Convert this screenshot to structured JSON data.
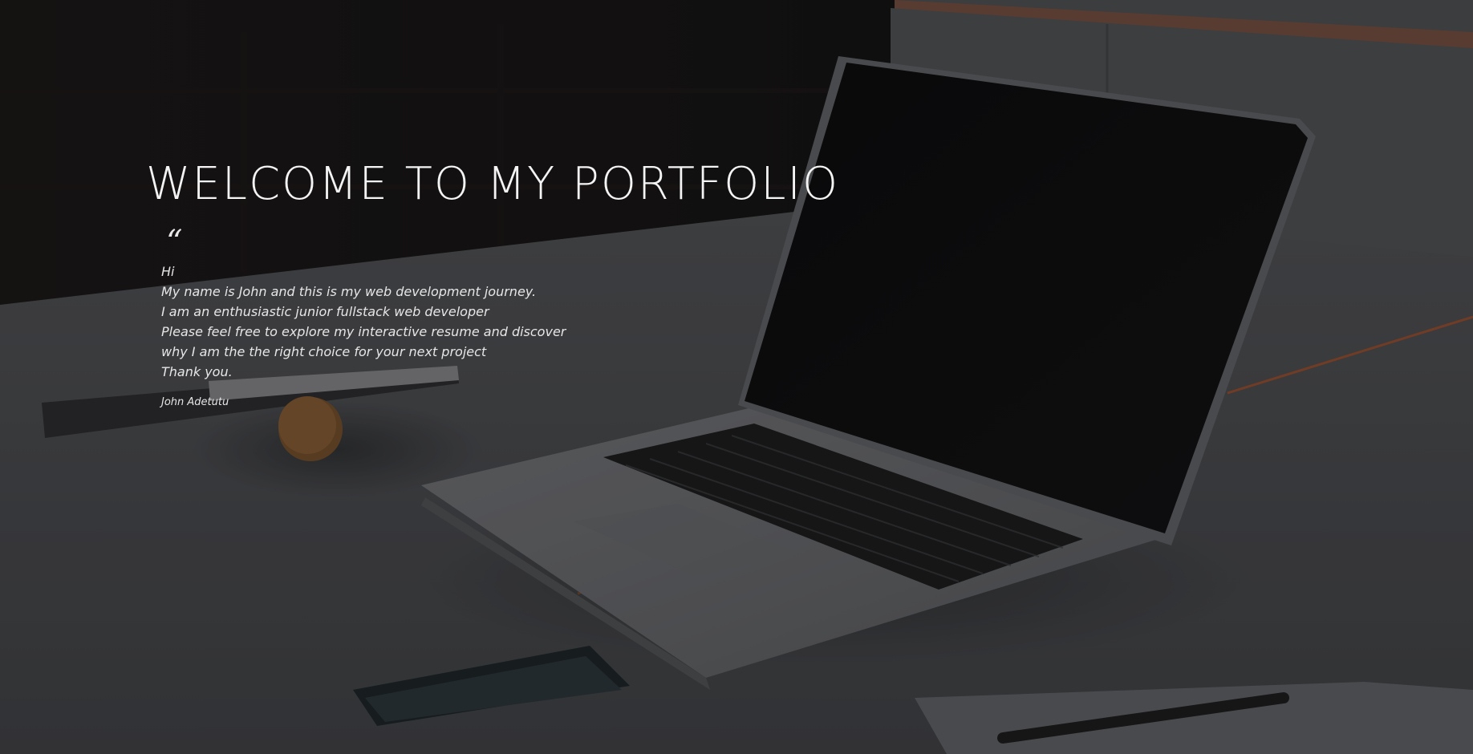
{
  "hero": {
    "title": "WELCOME TO MY PORTFOLIO",
    "quote_mark": "“",
    "lines": [
      "Hi",
      "My name is John and this is my web development journey.",
      "I am an enthusiastic junior fullstack web developer",
      "Please feel free to explore my interactive resume and discover",
      "why I am the the right choice for your next project",
      "Thank you."
    ],
    "signature": "John Adetutu"
  },
  "colors": {
    "text": "#f4f4f4",
    "accent_orange": "#c8561e",
    "background_dark": "#0c0c0d",
    "desk_gray": "#5a5b5e"
  },
  "background": {
    "image_subject": "laptop-on-desk-photo"
  }
}
